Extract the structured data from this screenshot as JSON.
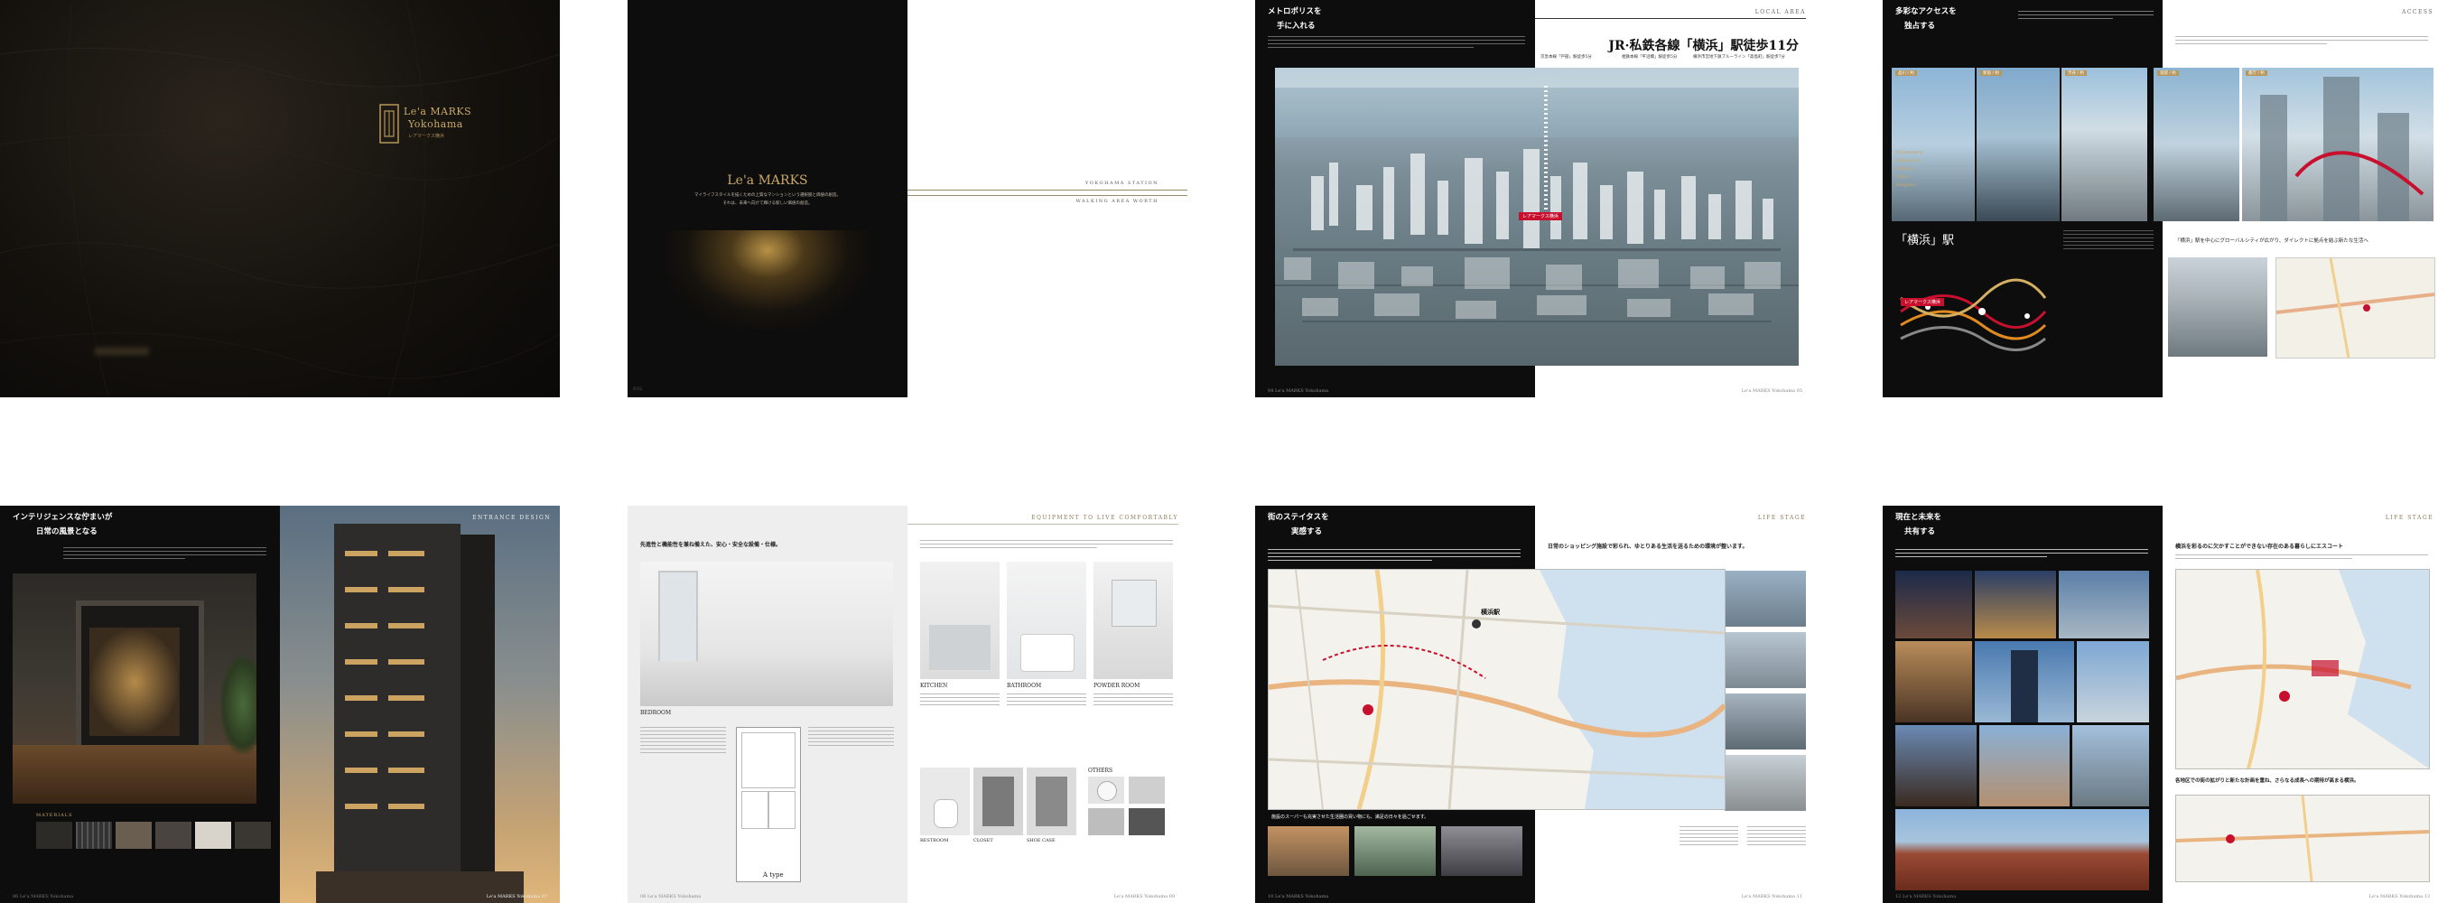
{
  "cover": {
    "brand_line1": "Le'a MARKS",
    "brand_line2": "Yokohama",
    "brand_sub": "レアマークス横浜"
  },
  "concept": {
    "brand": "Le'a MARKS",
    "text_line1": "マイライフスタイルを描くための上質なマンションという選択肢と価値の創造。",
    "text_line2": "それは、未来へ向けて輝ける新しい価値の創造。",
    "caption_line1": "YOKOHAMA STATION",
    "caption_line2": "WALKING AREA WORTH"
  },
  "location": {
    "heading_line1": "メトロポリスを",
    "heading_line2": "手に入れる",
    "tag": "LOCAL AREA",
    "headline": "JR·私鉄各線「横浜」駅徒歩11分",
    "sub1": "京急本線「戸部」駅徒歩5分",
    "sub2": "相鉄本線「平沼橋」駅徒歩5分",
    "sub3": "横浜市営地下鉄ブルーライン「高島町」駅徒歩7分",
    "marker": "レアマークス横浜",
    "footer_left": "04 Le'a MARKS Yokohama",
    "footer_right": "Le'a MARKS Yokohama 05"
  },
  "access": {
    "heading_line1": "多彩なアクセスを",
    "heading_line2": "独占する",
    "tag": "ACCESS",
    "photo_labels": [
      "品川 / 約",
      "新宿 / 約",
      "渋谷 / 約",
      "池袋 / 約",
      "都庁 / 約"
    ],
    "destinations": [
      "Minatomirai",
      "Shinagawa",
      "Shibuya",
      "Shibuya",
      "Tokyo",
      "Shinjuku"
    ],
    "station_label": "「横浜」駅",
    "map_title": "「横浜」駅を中心にグローバルシティが広がり、ダイレクトに拠点を結ぶ新たな生活へ",
    "route_marker": "レアマークス横浜"
  },
  "design": {
    "heading_line1": "インテリジェンスな佇まいが",
    "heading_line2": "日常の風景となる",
    "tag": "ENTRANCE DESIGN",
    "materials_label": "MATERIALS",
    "footer_left": "06 Le'a MARKS Yokohama",
    "footer_right": "Le'a MARKS Yokohama 07"
  },
  "equipment": {
    "tag": "EQUIPMENT TO LIVE COMFORTABLY",
    "intro": "先進性と機能性を兼ね備えた、安心・安全な設備・仕様。",
    "rooms": [
      "BEDROOM",
      "KITCHEN",
      "BATHROOM",
      "POWDER ROOM",
      "RESTROOM",
      "CLOSET",
      "SHOE CASE",
      "OTHERS"
    ],
    "plan_label": "A type",
    "footer_left": "08 Le'a MARKS Yokohama",
    "footer_right": "Le'a MARKS Yokohama 09"
  },
  "lifestage": {
    "heading_line1": "街のステイタスを",
    "heading_line2": "実感する",
    "tag": "LIFE STAGE",
    "map_caption": "日常のショッピング施設で彩られ、ゆとりある生活を送るための環境が整います。",
    "lower_banner": "施設のスーパーも充実させた生活圏の買い物にも、満足の日々を過ごせます。",
    "map_station": "横浜駅",
    "footer_left": "10 Le'a MARKS Yokohama",
    "footer_right": "Le'a MARKS Yokohama 11"
  },
  "future": {
    "heading_line1": "現在と未来を",
    "heading_line2": "共有する",
    "tag": "LIFE STAGE",
    "right_heading": "横浜を彩るのに欠かすことができない存在のある暮らしにエスコート",
    "right_sub": "各地区での街の拡がりと新たな計画を重ね、さらなる成長への期待が高まる横浜。",
    "footer_left": "12 Le'a MARKS Yokohama",
    "footer_right": "Le'a MARKS Yokohama 13"
  }
}
